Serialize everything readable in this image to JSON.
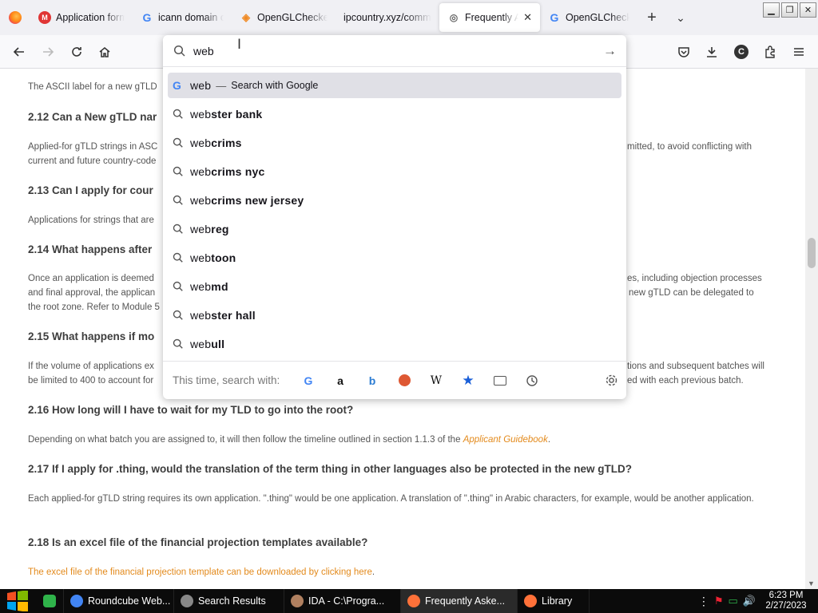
{
  "colors": {
    "accent_orange": "#e38a1c",
    "tab_bg": "#f0f0f4",
    "highlight": "#e0e0e6",
    "taskbar": "#0b0b0b"
  },
  "tabs": [
    {
      "title": "Application form",
      "icon": "app-form-icon"
    },
    {
      "title": "icann domain cre",
      "icon": "google-icon"
    },
    {
      "title": "OpenGLChecker",
      "icon": "openglchecker-icon"
    },
    {
      "title": "ipcountry.xyz/comme",
      "icon": "none"
    },
    {
      "title": "Frequently As",
      "icon": "icann-icon",
      "active": true
    },
    {
      "title": "OpenGLChecke",
      "icon": "google-icon"
    }
  ],
  "urlbar": {
    "value": "web",
    "first_suggestion": {
      "typed": "web",
      "separator": "—",
      "engine_text": "Search with Google"
    },
    "suggestions": [
      {
        "typed": "web",
        "rest": "ster bank"
      },
      {
        "typed": "web",
        "rest": "crims"
      },
      {
        "typed": "web",
        "rest": "crims nyc"
      },
      {
        "typed": "web",
        "rest": "crims new jersey"
      },
      {
        "typed": "web",
        "rest": "reg"
      },
      {
        "typed": "web",
        "rest": "toon"
      },
      {
        "typed": "web",
        "rest": "md"
      },
      {
        "typed": "web",
        "rest": "ster hall"
      },
      {
        "typed": "web",
        "rest": "ull"
      }
    ],
    "oneoff_label": "This time, search with:",
    "oneoff_engines": [
      "google-icon",
      "amazon-icon",
      "bing-icon",
      "duckduckgo-icon",
      "wikipedia-icon",
      "bookmarks-icon",
      "tabs-icon",
      "history-icon"
    ]
  },
  "page": {
    "line_top": "The ASCII label for a new gTLD",
    "h_212": "2.12 Can a New gTLD nar",
    "p_212a_left": "Applied-for gTLD strings in ASC",
    "p_212a_right": "mitted, to avoid conflicting with",
    "p_212b_left": "current and future country-code",
    "h_213": "2.13 Can I apply for cour",
    "p_213": "Applications for strings that are",
    "h_214": "2.14 What happens after",
    "p_214a_left": "Once an application is deemed",
    "p_214a_right": "es, including objection processes",
    "p_214b_left": "and final approval, the applican",
    "p_214b_right": "new gTLD can be delegated to",
    "p_214c_left": "the root zone. Refer to Module 5",
    "h_215": "2.15 What happens if mo",
    "p_215a_left": "If the volume of applications ex",
    "p_215a_right": "tions and subsequent batches will",
    "p_215b_left": "be limited to 400 to account for",
    "p_215b_right": "ed with each previous batch.",
    "h_216": "2.16 How long will I have to wait for my TLD to go into the root?",
    "p_216_pre": "Depending on what batch you are assigned to, it will then follow the timeline outlined in section 1.1.3 of the ",
    "p_216_link": "Applicant Guidebook",
    "p_216_post": ".",
    "h_217": "2.17 If I apply for .thing, would the translation of the term thing in other languages also be protected in the new gTLD?",
    "p_217": "Each applied-for gTLD string requires its own application. \".thing\" would be one application. A translation of \".thing\" in Arabic characters, for example, would be another application.",
    "h_218": "2.18 Is an excel file of the financial projection templates available?",
    "p_218_link": "The excel file of the financial projection template can be downloaded by clicking here",
    "p_218_post": "."
  },
  "taskbar": {
    "items": [
      {
        "label": "Roundcube Web...",
        "icon": "chrome-icon",
        "color": "#4285f4"
      },
      {
        "label": "Search Results",
        "icon": "search-results-icon",
        "color": "#888888"
      },
      {
        "label": "IDA - C:\\Progra...",
        "icon": "ida-icon",
        "color": "#b08060"
      },
      {
        "label": "Frequently Aske...",
        "icon": "firefox-icon",
        "color": "#ff7139",
        "active": true
      },
      {
        "label": "Library",
        "icon": "firefox-icon",
        "color": "#ff7139"
      }
    ],
    "time": "6:23 PM",
    "date": "2/27/2023"
  }
}
